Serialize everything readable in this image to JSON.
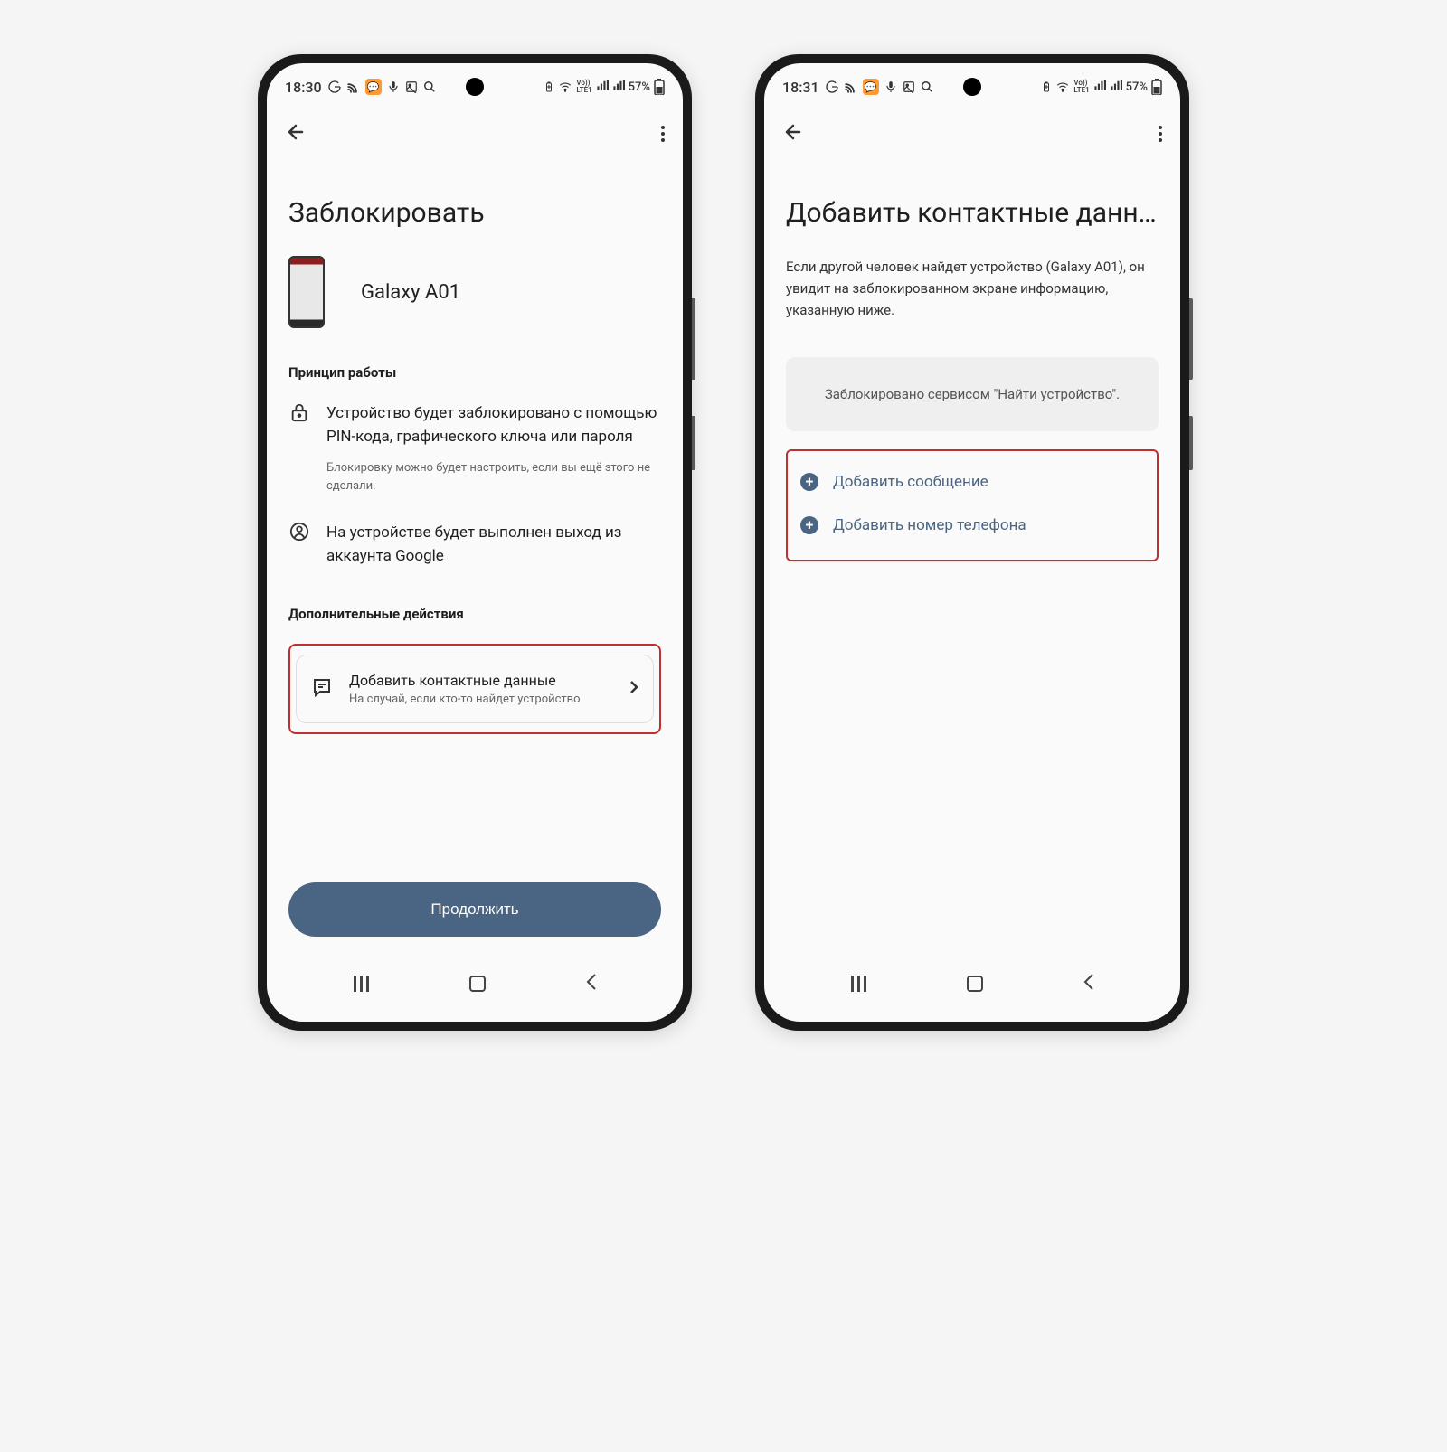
{
  "phone1": {
    "status": {
      "time": "18:30",
      "battery": "57%"
    },
    "title": "Заблокировать",
    "deviceName": "Galaxy A01",
    "section1": "Принцип работы",
    "info1": {
      "main": "Устройство будет заблокировано с помощью PIN-кода, графического ключа или пароля",
      "sub": "Блокировку можно будет настроить, если вы ещё этого не сделали."
    },
    "info2": {
      "main": "На устройстве будет выполнен выход из аккаунта Google"
    },
    "section2": "Дополнительные действия",
    "card": {
      "title": "Добавить контактные данные",
      "sub": "На случай, если кто-то найдет устройство"
    },
    "button": "Продолжить"
  },
  "phone2": {
    "status": {
      "time": "18:31",
      "battery": "57%"
    },
    "title": "Добавить контактные данн…",
    "desc": "Если другой человек найдет устройство (Galaxy A01), он увидит на заблокированном экране информацию, указанную ниже.",
    "boxText": "Заблокировано сервисом \"Найти устройство\".",
    "action1": "Добавить сообщение",
    "action2": "Добавить номер телефона"
  }
}
